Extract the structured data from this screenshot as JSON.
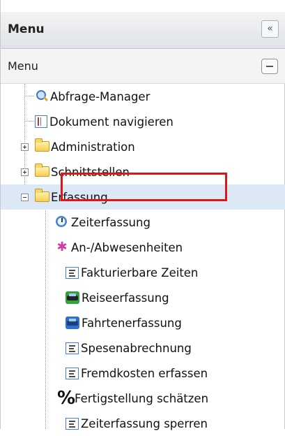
{
  "header": {
    "title": "Menu",
    "collapse_symbol": "«"
  },
  "subheader": {
    "title": "Menu"
  },
  "tree": {
    "items": [
      {
        "label": "Abfrage-Manager",
        "icon": "search-icon"
      },
      {
        "label": "Dokument navigieren",
        "icon": "document-icon"
      },
      {
        "label": "Administration",
        "icon": "folder-icon"
      },
      {
        "label": "Schnittstellen",
        "icon": "folder-icon"
      },
      {
        "label": "Erfassung",
        "icon": "folder-open-icon"
      },
      {
        "label": "Zeiterfassung",
        "icon": "clock-icon"
      },
      {
        "label": "An-/Abwesenheiten",
        "icon": "star-icon"
      },
      {
        "label": "Fakturierbare Zeiten",
        "icon": "list-icon"
      },
      {
        "label": "Reiseerfassung",
        "icon": "car-icon"
      },
      {
        "label": "Fahrtenerfassung",
        "icon": "car-icon"
      },
      {
        "label": "Spesenabrechnung",
        "icon": "list-icon"
      },
      {
        "label": "Fremdkosten erfassen",
        "icon": "list-icon"
      },
      {
        "label": "Fertigstellung schätzen",
        "icon": "percent-icon"
      },
      {
        "label": "Zeiterfassung sperren",
        "icon": "list-icon"
      }
    ]
  },
  "colors": {
    "highlight": "#e11414",
    "selected_row": "#dde8f6",
    "folder": "#f6cf4f"
  }
}
